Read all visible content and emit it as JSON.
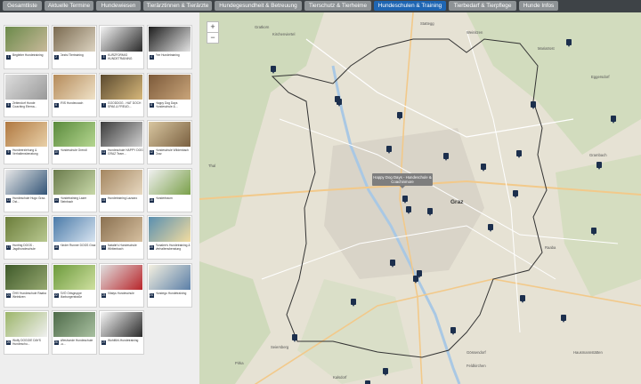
{
  "tabs": [
    {
      "label": "Gesamtliste",
      "active": false
    },
    {
      "label": "Aktuelle Termine",
      "active": false
    },
    {
      "label": "Hundewiesen",
      "active": false
    },
    {
      "label": "Tierärztinnen & Tierärzte",
      "active": false
    },
    {
      "label": "Hundegesundheit & Betreuung",
      "active": false
    },
    {
      "label": "Tierschutz & Tierheime",
      "active": false
    },
    {
      "label": "Hundeschulen & Training",
      "active": true
    },
    {
      "label": "Tierbedarf & Tierpflege",
      "active": false
    },
    {
      "label": "Hunde Infos",
      "active": false
    }
  ],
  "cards": [
    {
      "num": "1",
      "label": "Begleiter Hundetraining"
    },
    {
      "num": "2",
      "label": "Dezisi Tiertraining"
    },
    {
      "num": "3",
      "label": "KURZFORMIG HUNDETRAINING"
    },
    {
      "num": "4",
      "label": "Fee Hundetraining"
    },
    {
      "num": "5",
      "label": "Zeitendorf Hunde Coaching Eterna..."
    },
    {
      "num": "6",
      "label": "IRIS Hundecoach"
    },
    {
      "num": "7",
      "label": "GOODDOG - HAT DOCH SPAß & FREUD..."
    },
    {
      "num": "8",
      "label": "Happy Dog Days Hundeschule &..."
    },
    {
      "num": "9",
      "label": "Hundeerziehung & Verhaltensberatung"
    },
    {
      "num": "10",
      "label": "Hundeschule Grendl"
    },
    {
      "num": "11",
      "label": "Hundeschule HAPPY DOG GRAZ Team..."
    },
    {
      "num": "12",
      "label": "Hundeschule Wildenbach Graz"
    },
    {
      "num": "13",
      "label": "Hundeschule Hugo Graz-Ost..."
    },
    {
      "num": "14",
      "label": "Hundetraining Lazer Steinbach"
    },
    {
      "num": "15",
      "label": "Hundetraining Lazzaro"
    },
    {
      "num": "16",
      "label": "Hundertraum"
    },
    {
      "num": "17",
      "label": "Hunting DOGS - Jagdhundeschule"
    },
    {
      "num": "18",
      "label": "Kinder Runner DOGS Graz"
    },
    {
      "num": "19",
      "label": "Natalie's Hundeschule Whitenbach"
    },
    {
      "num": "20",
      "label": "Ronalee's Hundetraining & Verhaltensberatung"
    },
    {
      "num": "21",
      "label": "ÖHV Hundeschule Raaba Weinitzen"
    },
    {
      "num": "22",
      "label": "SVÖ Ortsgruppe Marburgerstraße"
    },
    {
      "num": "23",
      "label": "Vitalys Hundeschule"
    },
    {
      "num": "24",
      "label": "Hundego Hundetraining"
    },
    {
      "num": "25",
      "label": "Wolfy DOGGIE DAYS Hundeschu..."
    },
    {
      "num": "26",
      "label": "Wieshunde Hundeschule Lu..."
    },
    {
      "num": "27",
      "label": "Wohlfühl-Hundetraining"
    }
  ],
  "map": {
    "zoom_in": "+",
    "zoom_out": "−",
    "tooltip": "Happy Dog Days - Hundeschule & Coachinmore",
    "places": [
      "Gratkorn",
      "Kirchenviertel",
      "Weinitzen",
      "Graz",
      "Raaba",
      "Grambach",
      "Seiersberg",
      "Thal",
      "Hausmannstätten",
      "Gössendorf",
      "Feldkirchen",
      "Mariatrost",
      "Stattegg",
      "Kalsdorf",
      "Pirka",
      "Eggersdorf"
    ]
  }
}
